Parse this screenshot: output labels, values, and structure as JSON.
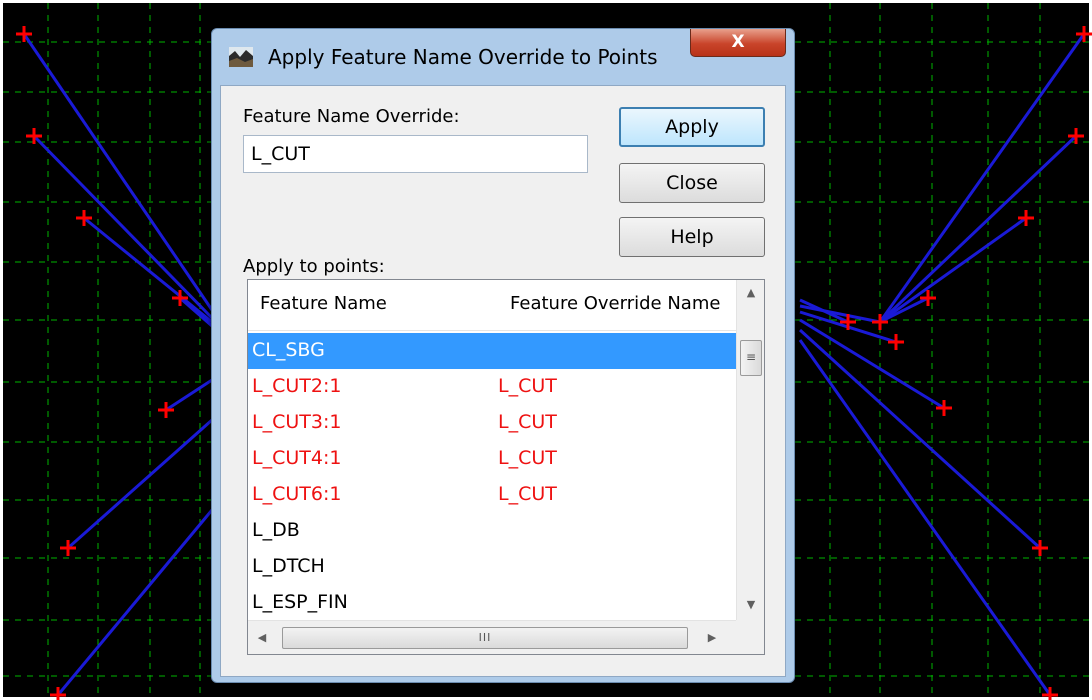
{
  "colors": {
    "background": "#000000",
    "grid": "#00b400",
    "lines": "#1a1ad6",
    "markers": "#ff0000",
    "override_text": "#ee1111",
    "selection": "#3399ff"
  },
  "dialog": {
    "title": "Apply Feature Name Override to Points",
    "close_glyph": "X",
    "override_label": "Feature Name Override:",
    "override_value": "L_CUT",
    "apply_label": "Apply",
    "close_label": "Close",
    "help_label": "Help",
    "points_label": "Apply to points:",
    "list": {
      "headers": [
        "Feature Name",
        "Feature Override Name"
      ],
      "rows": [
        {
          "name": "CL_SBG",
          "override": "",
          "selected": true
        },
        {
          "name": "L_CUT2:1",
          "override": "L_CUT",
          "overridden": true
        },
        {
          "name": "L_CUT3:1",
          "override": "L_CUT",
          "overridden": true
        },
        {
          "name": "L_CUT4:1",
          "override": "L_CUT",
          "overridden": true
        },
        {
          "name": "L_CUT6:1",
          "override": "L_CUT",
          "overridden": true
        },
        {
          "name": "L_DB",
          "override": ""
        },
        {
          "name": "L_DTCH",
          "override": ""
        },
        {
          "name": "L_ESP_FIN",
          "override": ""
        }
      ]
    },
    "scroll_icons": {
      "up": "▲",
      "down": "▼",
      "left": "◀",
      "right": "▶",
      "v_grip": "≡",
      "h_grip": "III"
    }
  }
}
